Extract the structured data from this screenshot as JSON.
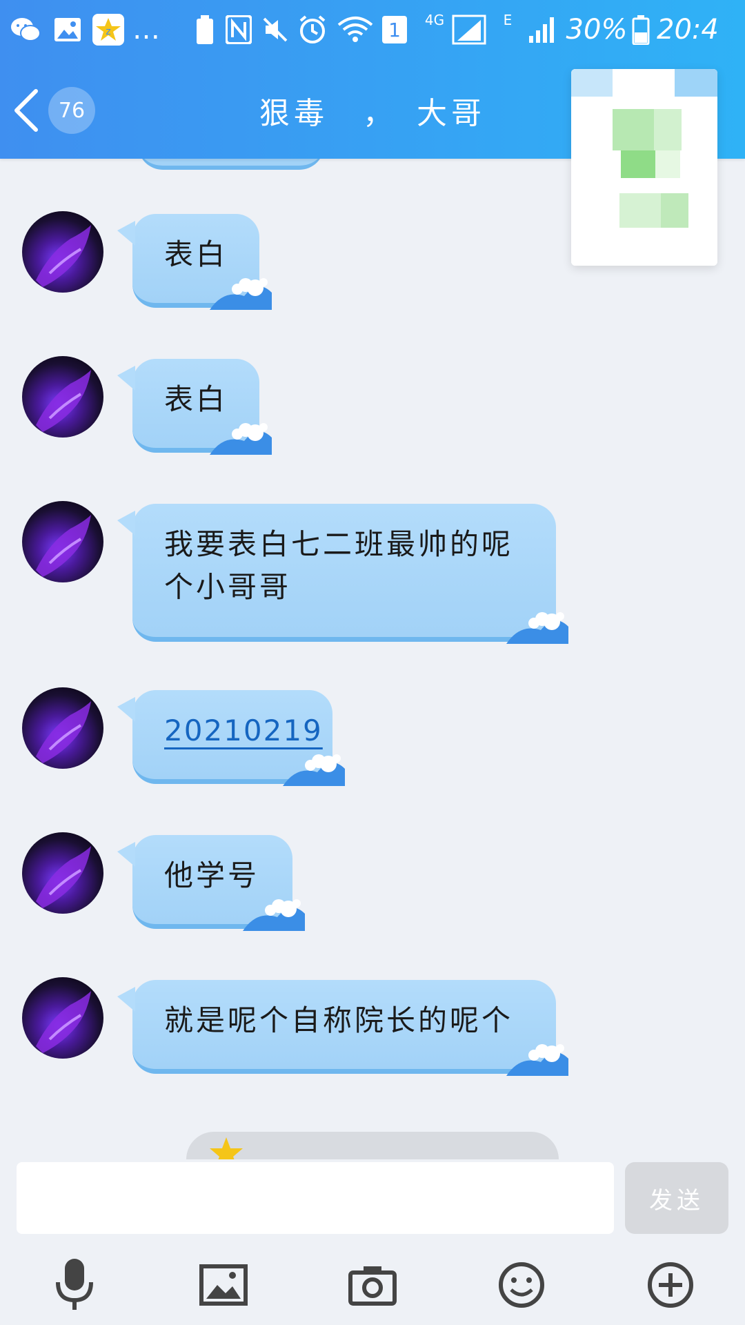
{
  "status_bar": {
    "battery_percent": "30%",
    "time": "20:4",
    "network_label": "4G",
    "sim_slot": "1",
    "edge_label": "E"
  },
  "header": {
    "back_badge": "76",
    "title": "狠毒　，　大哥"
  },
  "messages": [
    {
      "text": "表白"
    },
    {
      "text": "表白"
    },
    {
      "text": "我要表白七二班最帅的呢个小哥哥"
    },
    {
      "text": "20210219",
      "is_link": true
    },
    {
      "text": "他学号"
    },
    {
      "text": "就是呢个自称院长的呢个"
    }
  ],
  "composer": {
    "send_label": "发送",
    "input_value": ""
  },
  "toolbar": {
    "icons": [
      "microphone-icon",
      "image-icon",
      "camera-icon",
      "emoji-icon",
      "plus-icon"
    ]
  },
  "colors": {
    "header_start": "#3f8ff0",
    "header_end": "#2fb2f6",
    "bubble": "#a9d6f8",
    "background": "#eef1f6",
    "link": "#1565c0"
  }
}
